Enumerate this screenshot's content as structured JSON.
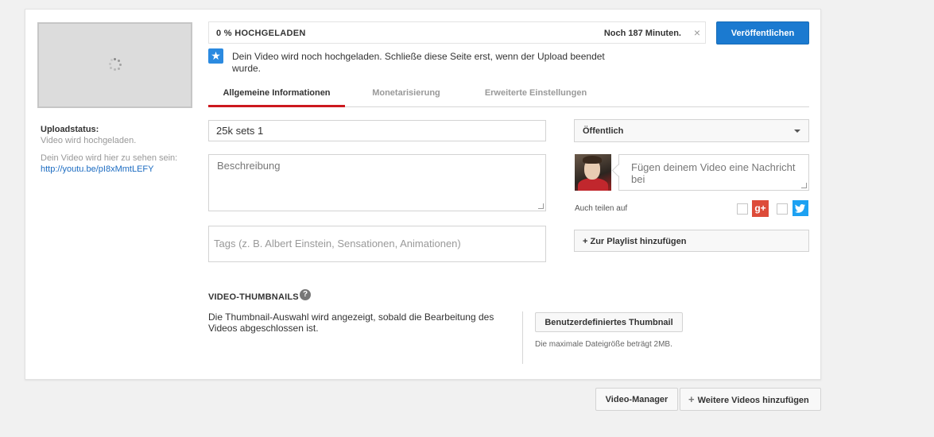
{
  "upload": {
    "progress_label": "0 % HOCHGELADEN",
    "progress_percent": 0,
    "time_remaining": "Noch 187 Minuten.",
    "close_symbol": "×",
    "publish_label": "Veröffentlichen",
    "notice": "Dein Video wird noch hochgeladen. Schließe diese Seite erst, wenn der Upload beendet wurde."
  },
  "sidebar": {
    "status_title": "Uploadstatus:",
    "status_text": "Video wird hochgeladen.",
    "visible_at": "Dein Video wird hier zu sehen sein:",
    "video_link": "http://youtu.be/pI8xMmtLEFY"
  },
  "tabs": [
    {
      "label": "Allgemeine Informationen",
      "active": true
    },
    {
      "label": "Monetarisierung",
      "active": false
    },
    {
      "label": "Erweiterte Einstellungen",
      "active": false
    }
  ],
  "form": {
    "title_value": "25k sets 1",
    "description_placeholder": "Beschreibung",
    "tags_placeholder": "Tags (z. B. Albert Einstein, Sensationen, Animationen)",
    "privacy_value": "Öffentlich",
    "message_placeholder": "Fügen deinem Video eine Nachricht bei",
    "share_label": "Auch teilen auf",
    "gplus_label": "g+",
    "playlist_label": "+ Zur Playlist hinzufügen"
  },
  "thumbnails": {
    "title": "VIDEO-THUMBNAILS",
    "help_symbol": "?",
    "description": "Die Thumbnail-Auswahl wird angezeigt, sobald die Bearbeitung des Videos abgeschlossen ist.",
    "custom_button": "Benutzerdefiniertes Thumbnail",
    "max_size": "Die maximale Dateigröße beträgt 2MB."
  },
  "footer": {
    "manager_label": "Video-Manager",
    "more_plus": "+",
    "more_label": "Weitere Videos hinzufügen"
  },
  "colors": {
    "accent_blue": "#1b7ad0",
    "tab_active_red": "#cc181e",
    "gplus_red": "#dd4b39",
    "twitter_blue": "#1da1f2"
  },
  "icons": [
    "star-icon",
    "close-icon",
    "caret-down-icon",
    "gplus-icon",
    "twitter-icon",
    "help-icon",
    "plus-icon",
    "loading-spinner-icon"
  ]
}
